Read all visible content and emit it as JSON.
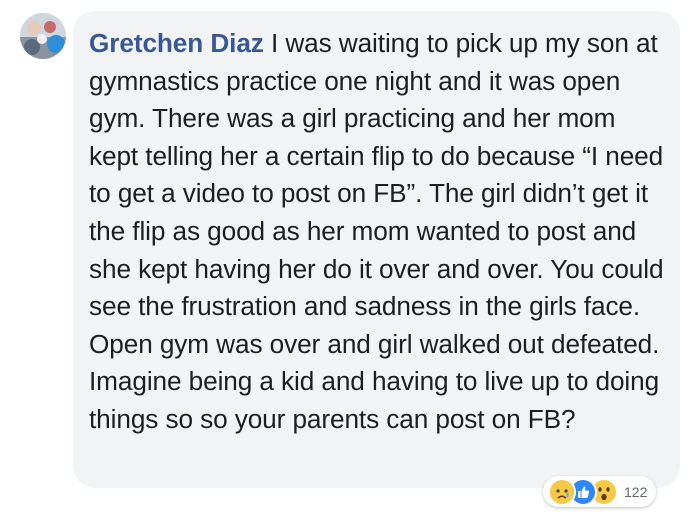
{
  "comment": {
    "author": "Gretchen Diaz",
    "body": "I was waiting to pick up my son at gymnastics practice one night and it was open gym. There was a girl practicing and her mom kept telling her a certain flip to do because “I need to get a video to post on FB”. The girl didn’t get it the flip as good as her mom wanted to post and she kept having her do it over and over. You could see the frustration and sadness in the girls face. Open gym was over and girl walked out defeated. Imagine being a kid and having to live up to doing things so so your parents can post on FB?"
  },
  "reactions": {
    "icons": [
      "sad-icon",
      "like-icon",
      "wow-icon"
    ],
    "count": "122"
  },
  "colors": {
    "author": "#385898",
    "bubble": "#f2f3f5",
    "text": "#1c1e21"
  }
}
